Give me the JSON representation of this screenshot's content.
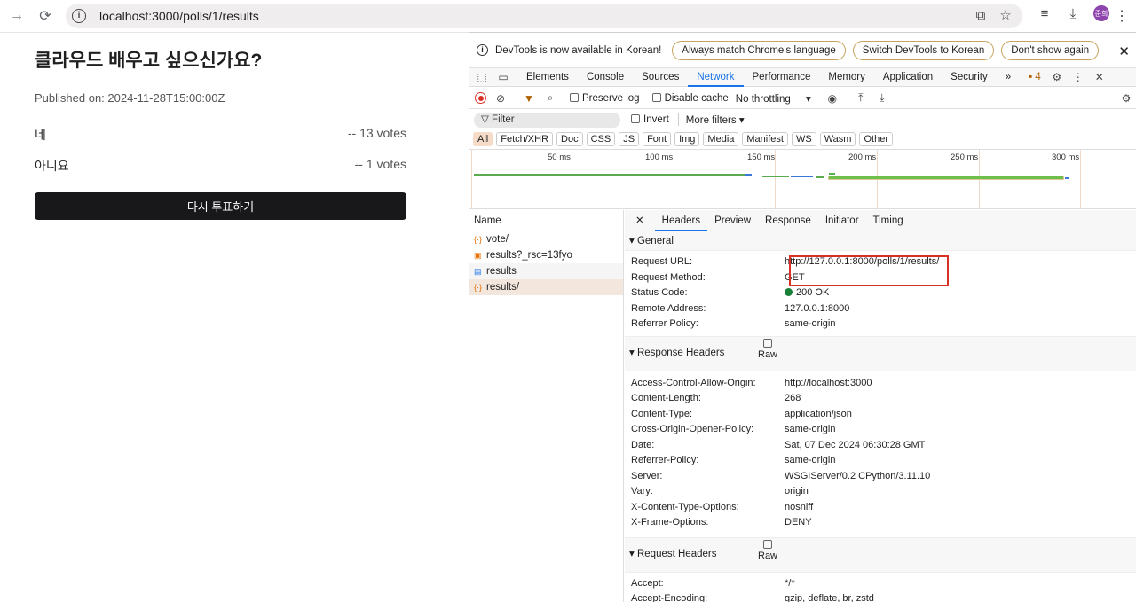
{
  "browser": {
    "url": "localhost:3000/polls/1/results",
    "avatar_text": "준희"
  },
  "page": {
    "title": "클라우드 배우고 싶으신가요?",
    "published": "Published on: 2024-11-28T15:00:00Z",
    "options": [
      {
        "label": "네",
        "votes": "-- 13 votes"
      },
      {
        "label": "아니요",
        "votes": "-- 1 votes"
      }
    ],
    "revote_label": "다시 투표하기"
  },
  "devtools": {
    "infobar": {
      "message": "DevTools is now available in Korean!",
      "btn_match": "Always match Chrome's language",
      "btn_switch": "Switch DevTools to Korean",
      "btn_dont": "Don't show again"
    },
    "tabs": [
      "Elements",
      "Console",
      "Sources",
      "Network",
      "Performance",
      "Memory",
      "Application",
      "Security"
    ],
    "issues_count": "4",
    "toolbar": {
      "preserve_log": "Preserve log",
      "disable_cache": "Disable cache",
      "throttling": "No throttling"
    },
    "filter": {
      "placeholder": "Filter",
      "invert": "Invert",
      "more_filters": "More filters"
    },
    "types": [
      "All",
      "Fetch/XHR",
      "Doc",
      "CSS",
      "JS",
      "Font",
      "Img",
      "Media",
      "Manifest",
      "WS",
      "Wasm",
      "Other"
    ],
    "timeline_labels": [
      "50 ms",
      "100 ms",
      "150 ms",
      "200 ms",
      "250 ms",
      "300 ms"
    ],
    "list": {
      "header": "Name",
      "items": [
        "vote/",
        "results?_rsc=13fyo",
        "results",
        "results/"
      ]
    },
    "detail_tabs": [
      "Headers",
      "Preview",
      "Response",
      "Initiator",
      "Timing"
    ],
    "general": {
      "title": "General",
      "rows": [
        {
          "k": "Request URL:",
          "v": "http://127.0.0.1:8000/polls/1/results/"
        },
        {
          "k": "Request Method:",
          "v": "GET"
        },
        {
          "k": "Status Code:",
          "v": "200 OK"
        },
        {
          "k": "Remote Address:",
          "v": "127.0.0.1:8000"
        },
        {
          "k": "Referrer Policy:",
          "v": "same-origin"
        }
      ]
    },
    "response_headers": {
      "title": "Response Headers",
      "raw": "Raw",
      "rows": [
        {
          "k": "Access-Control-Allow-Origin:",
          "v": "http://localhost:3000"
        },
        {
          "k": "Content-Length:",
          "v": "268"
        },
        {
          "k": "Content-Type:",
          "v": "application/json"
        },
        {
          "k": "Cross-Origin-Opener-Policy:",
          "v": "same-origin"
        },
        {
          "k": "Date:",
          "v": "Sat, 07 Dec 2024 06:30:28 GMT"
        },
        {
          "k": "Referrer-Policy:",
          "v": "same-origin"
        },
        {
          "k": "Server:",
          "v": "WSGIServer/0.2 CPython/3.11.10"
        },
        {
          "k": "Vary:",
          "v": "origin"
        },
        {
          "k": "X-Content-Type-Options:",
          "v": "nosniff"
        },
        {
          "k": "X-Frame-Options:",
          "v": "DENY"
        }
      ]
    },
    "request_headers": {
      "title": "Request Headers",
      "raw": "Raw",
      "rows": [
        {
          "k": "Accept:",
          "v": "*/*"
        },
        {
          "k": "Accept-Encoding:",
          "v": "gzip, deflate, br, zstd"
        }
      ]
    }
  }
}
